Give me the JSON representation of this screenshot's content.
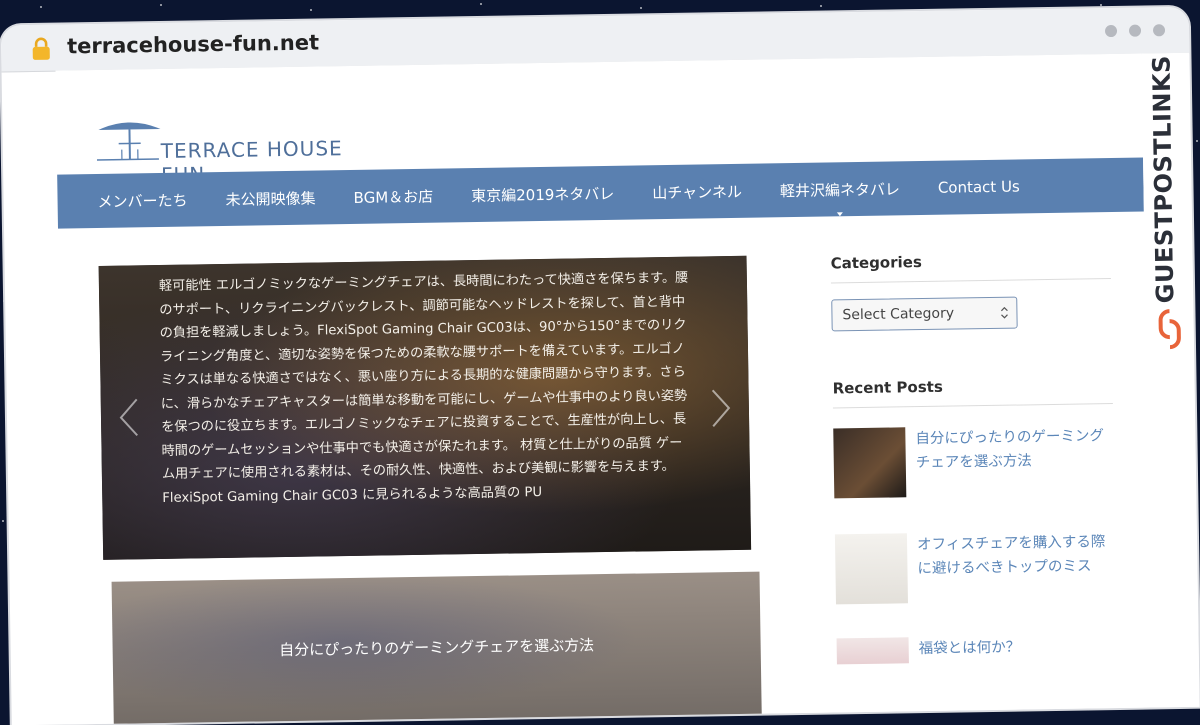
{
  "browser": {
    "url": "terracehouse-fun.net"
  },
  "sidebar_brand": {
    "text": "GUESTPOSTLINKS"
  },
  "site": {
    "logo_text": "TERRACE HOUSE FUN"
  },
  "nav": {
    "items": [
      {
        "label": "メンバーたち"
      },
      {
        "label": "未公開映像集"
      },
      {
        "label": "BGM＆お店"
      },
      {
        "label": "東京編2019ネタバレ"
      },
      {
        "label": "山チャンネル"
      },
      {
        "label": "軽井沢編ネタバレ"
      },
      {
        "label": "Contact Us"
      }
    ]
  },
  "slider": {
    "text": "軽可能性 エルゴノミックなゲーミングチェアは、長時間にわたって快適さを保ちます。腰のサポート、リクライニングバックレスト、調節可能なヘッドレストを探して、首と背中の負担を軽減しましょう。FlexiSpot Gaming Chair GC03は、90°から150°までのリクライニング角度と、適切な姿勢を保つための柔軟な腰サポートを備えています。エルゴノミクスは単なる快適さではなく、悪い座り方による長期的な健康問題から守ります。さらに、滑らかなチェアキャスターは簡単な移動を可能にし、ゲームや仕事中のより良い姿勢を保つのに役立ちます。エルゴノミックなチェアに投資することで、生産性が向上し、長時間のゲームセッションや仕事中でも快適さが保たれます。 材質と仕上がりの品質 ゲーム用チェアに使用される素材は、その耐久性、快適性、および美観に影響を与えます。FlexiSpot Gaming Chair GC03 に見られるような高品質の PU"
  },
  "card2": {
    "title": "自分にぴったりのゲーミングチェアを選ぶ方法"
  },
  "sidebar": {
    "categories_title": "Categories",
    "category_select_value": "Select Category",
    "recent_title": "Recent Posts",
    "recent_posts": [
      {
        "title": "自分にぴったりのゲーミングチェアを選ぶ方法"
      },
      {
        "title": "オフィスチェアを購入する際に避けるべきトップのミス"
      },
      {
        "title": "福袋とは何か？"
      }
    ]
  },
  "colors": {
    "nav_bg": "#5a80b0",
    "link": "#5b86b8",
    "logo": "#4f6f9a",
    "brand_accent": "#e8643a"
  }
}
